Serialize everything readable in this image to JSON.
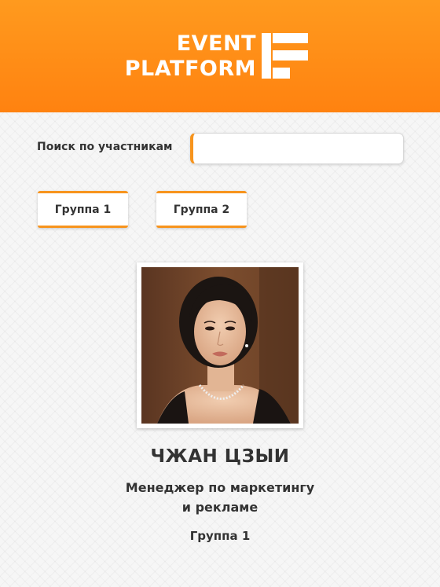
{
  "header": {
    "logo_line1": "EVENT",
    "logo_line2": "PLATFORM",
    "brand_color": "#ff8c16"
  },
  "search": {
    "label": "Поиск по участникам",
    "value": "",
    "placeholder": ""
  },
  "groups": [
    {
      "label": "Группа 1"
    },
    {
      "label": "Группа 2"
    }
  ],
  "participant": {
    "name": "ЧЖАН ЦЗЫИ",
    "role_line1": "Менеджер по маркетингу",
    "role_line2": "и рекламе",
    "group": "Группа 1"
  }
}
